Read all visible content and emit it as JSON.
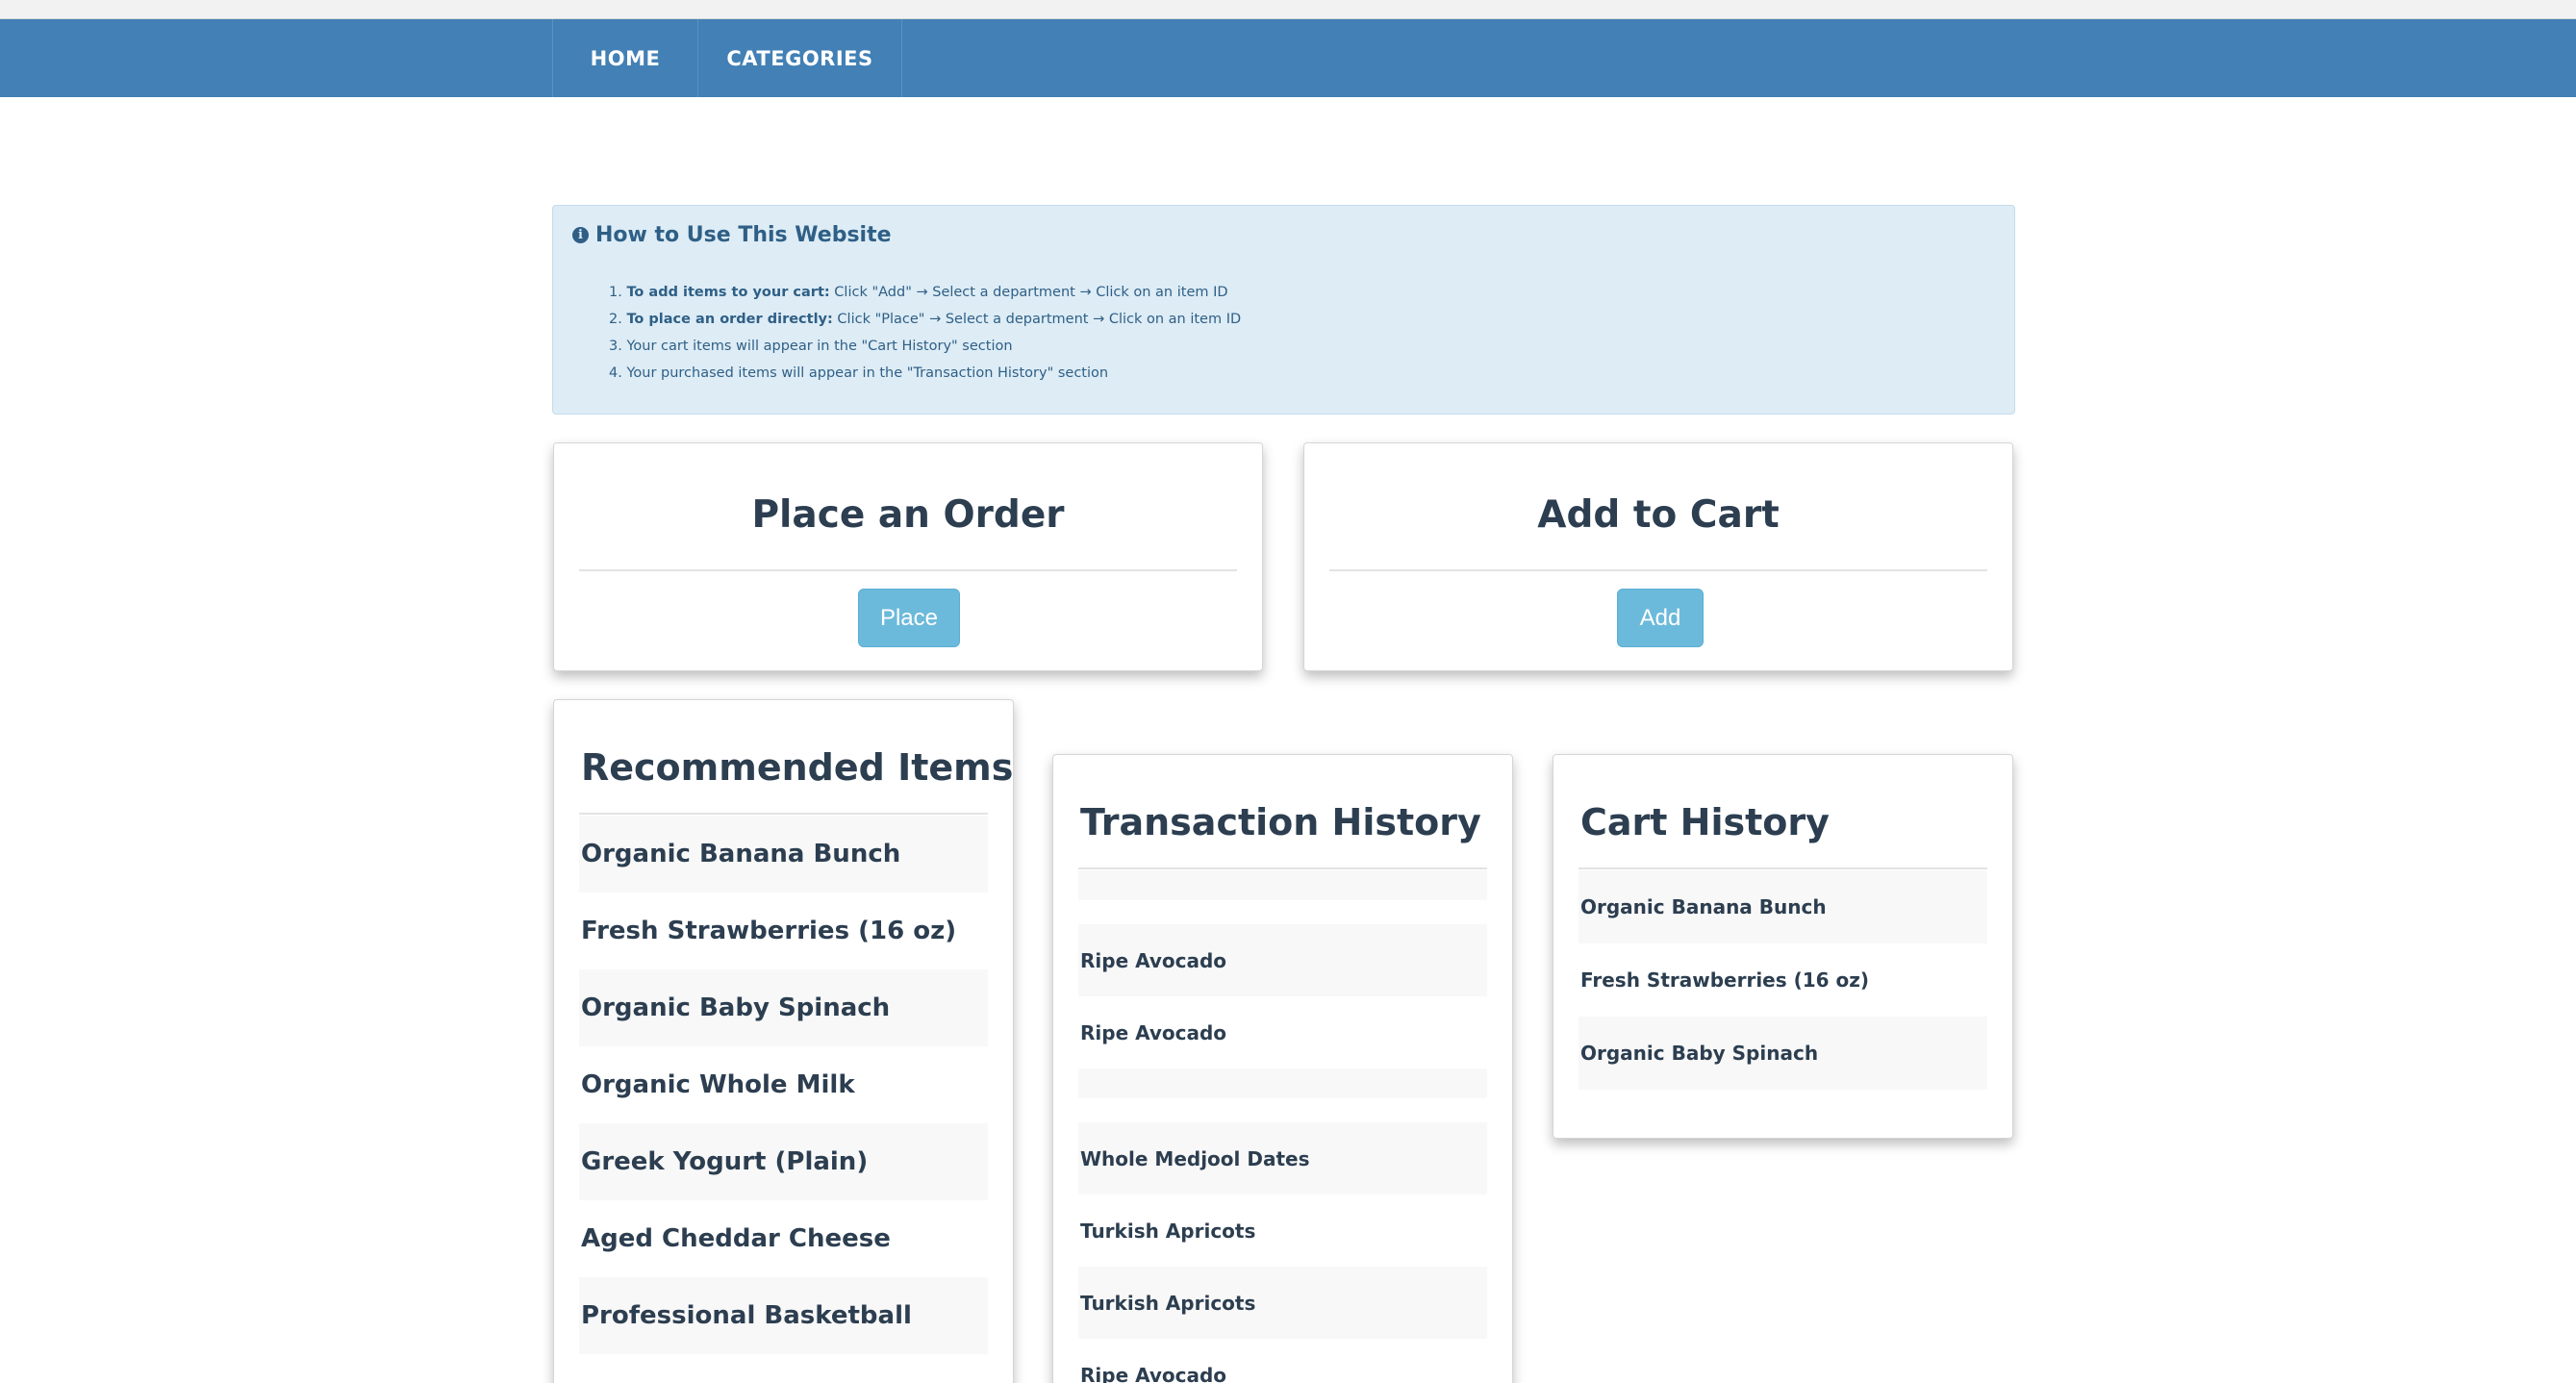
{
  "nav": {
    "home": "HOME",
    "categories": "CATEGORIES"
  },
  "info": {
    "title": "How to Use This Website",
    "icon": "info-circle-icon",
    "steps": [
      {
        "num": "1.",
        "bold": "To add items to your cart:",
        "text": " Click \"Add\" → Select a department → Click on an item ID"
      },
      {
        "num": "2.",
        "bold": "To place an order directly:",
        "text": " Click \"Place\" → Select a department → Click on an item ID"
      },
      {
        "num": "3.",
        "bold": "",
        "text": "Your cart items will appear in the \"Cart History\" section"
      },
      {
        "num": "4.",
        "bold": "",
        "text": "Your purchased items will appear in the \"Transaction History\" section"
      }
    ]
  },
  "order_card": {
    "title": "Place an Order",
    "button": "Place"
  },
  "cart_card": {
    "title": "Add to Cart",
    "button": "Add"
  },
  "recommended": {
    "title": "Recommended Items",
    "items": [
      "Organic Banana Bunch",
      "Fresh Strawberries (16 oz)",
      "Organic Baby Spinach",
      "Organic Whole Milk",
      "Greek Yogurt (Plain)",
      "Aged Cheddar Cheese",
      "Professional Basketball"
    ]
  },
  "transactions": {
    "title": "Transaction History",
    "items": [
      "",
      "Ripe Avocado",
      "Ripe Avocado",
      "",
      "Whole Medjool Dates",
      "Turkish Apricots",
      "Turkish Apricots",
      "Ripe Avocado"
    ]
  },
  "cart_history": {
    "title": "Cart History",
    "items": [
      "Organic Banana Bunch",
      "Fresh Strawberries (16 oz)",
      "Organic Baby Spinach"
    ]
  },
  "colors": {
    "navbar": "#4280b5",
    "info_bg": "#ddecf5",
    "button": "#6cbadb",
    "text": "#2c3e50"
  }
}
